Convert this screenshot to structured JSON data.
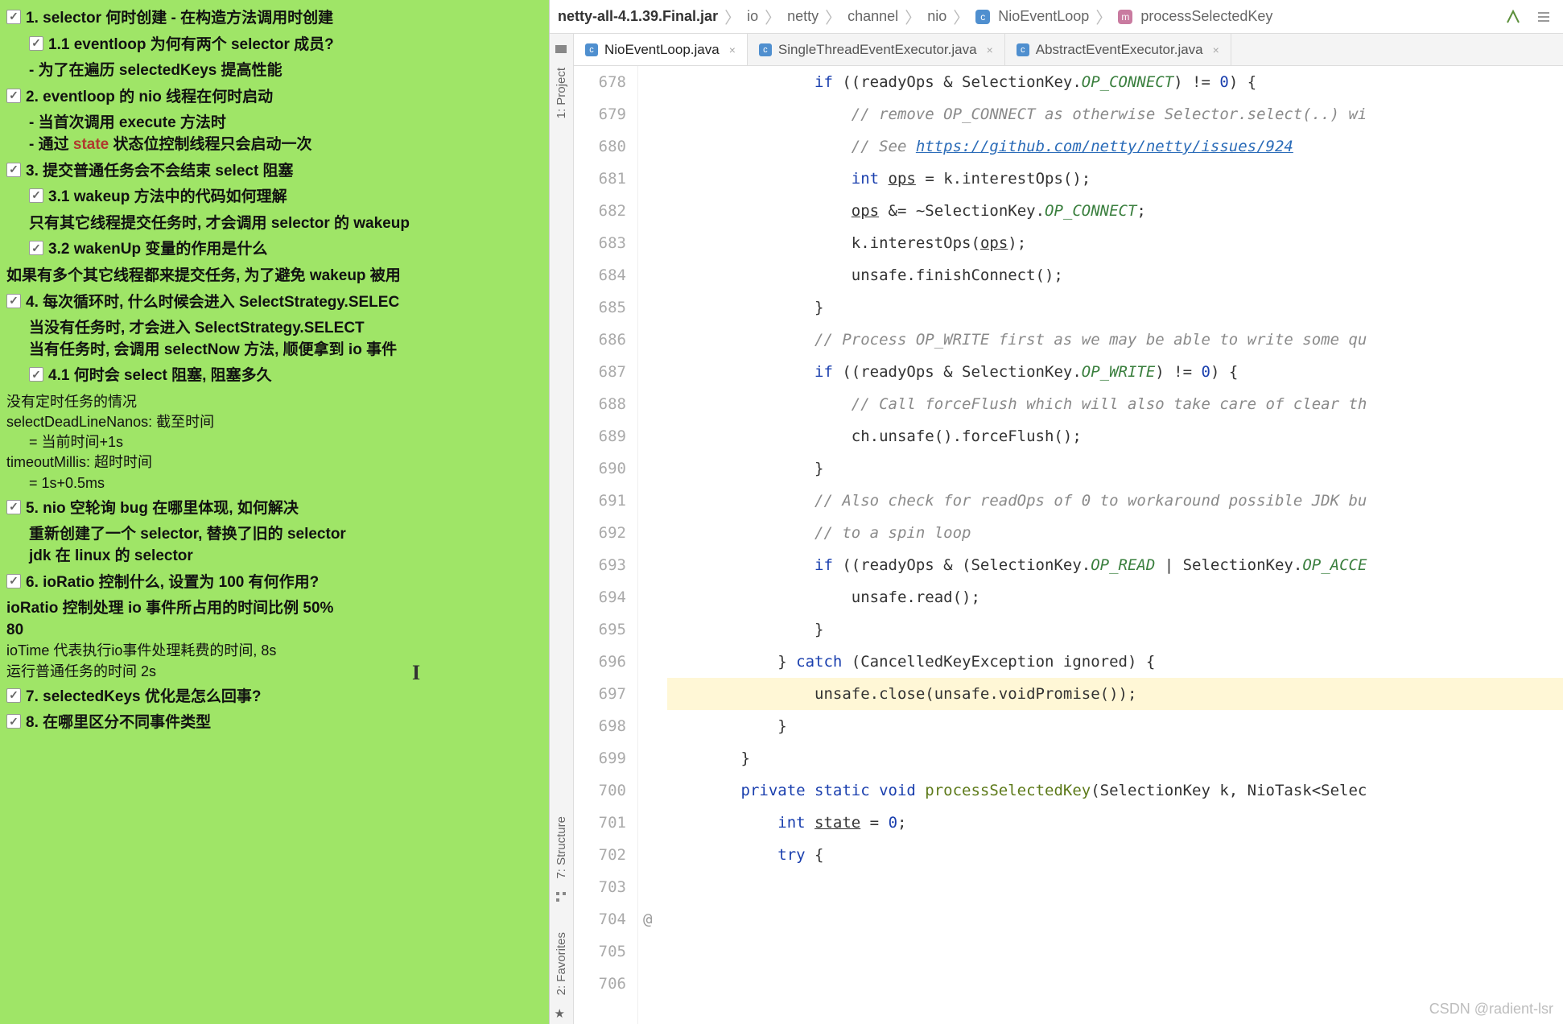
{
  "notes": {
    "n1": {
      "label": "1. selector 何时创建 - 在构造方法调用时创建"
    },
    "n1_1": {
      "label": "1.1 eventloop 为何有两个 selector 成员?",
      "sub": "- 为了在遍历 selectedKeys 提高性能"
    },
    "n2": {
      "label": "2. eventloop 的 nio 线程在何时启动",
      "sub1_a": "- 当首次调用 ",
      "sub1_b": "execute 方法时",
      "sub2_a": "- 通过 ",
      "sub2_b": "state",
      "sub2_c": " 状态位控制线程只会启动一次"
    },
    "n3": {
      "label": "3. 提交普通任务会不会结束 select 阻塞"
    },
    "n3_1": {
      "label": "3.1 wakeup 方法中的代码如何理解",
      "sub": "只有其它线程提交任务时, 才会调用 selector 的 wakeup"
    },
    "n3_2": {
      "label": "3.2 wakenUp 变量的作用是什么",
      "sub": "如果有多个其它线程都来提交任务, 为了避免 wakeup 被用"
    },
    "n4": {
      "label": "4. 每次循环时, 什么时候会进入 SelectStrategy.SELEC",
      "sub1": "当没有任务时, 才会进入 SelectStrategy.SELECT",
      "sub2": "当有任务时, 会调用 selectNow 方法, 顺便拿到 io 事件"
    },
    "n4_1": {
      "label": "4.1 何时会 select 阻塞, 阻塞多久",
      "p1": "没有定时任务的情况",
      "p2": "selectDeadLineNanos: 截至时间",
      "p3": "= 当前时间+1s",
      "p4": "timeoutMillis: 超时时间",
      "p5": "= 1s+0.5ms"
    },
    "n5": {
      "label": "5. nio 空轮询 bug 在哪里体现, 如何解决",
      "sub1": "重新创建了一个 selector, 替换了旧的 selector",
      "sub2": "jdk 在 linux 的 selector"
    },
    "n6": {
      "label": "6. ioRatio 控制什么, 设置为 100 有何作用?",
      "p1": "ioRatio 控制处理 io 事件所占用的时间比例 50%",
      "p2": "80",
      "p3": "ioTime 代表执行io事件处理耗费的时间, 8s",
      "p4": "运行普通任务的时间 2s"
    },
    "n7": {
      "label": "7. selectedKeys 优化是怎么回事?"
    },
    "n8": {
      "label": "8. 在哪里区分不同事件类型"
    },
    "check": "✓"
  },
  "crumb": {
    "jar": "netty-all-4.1.39.Final.jar",
    "p1": "io",
    "p2": "netty",
    "p3": "channel",
    "p4": "nio",
    "cls": "NioEventLoop",
    "mtd": "processSelectedKey",
    "ci_c": "c",
    "ci_m": "m"
  },
  "sidetabs": {
    "t1": "1: Project",
    "t2": "7: Structure",
    "t3": "2: Favorites"
  },
  "tabs": {
    "t1": "NioEventLoop.java",
    "t2": "SingleThreadEventExecutor.java",
    "t3": "AbstractEventExecutor.java",
    "x": "×",
    "c": "c"
  },
  "code": {
    "lines": [
      "678",
      "679",
      "680",
      "681",
      "682",
      "683",
      "684",
      "685",
      "686",
      "687",
      "688",
      "689",
      "690",
      "691",
      "692",
      "693",
      "694",
      "695",
      "696",
      "697",
      "698",
      "699",
      "700",
      "701",
      "702",
      "703",
      "704",
      "705",
      "706"
    ],
    "at": "@",
    "l678a": "                if ",
    "l678b": "((readyOps & SelectionKey.",
    "l678c": "OP_CONNECT",
    "l678d": ") != ",
    "l678e": "0",
    "l678f": ") {",
    "l679": "                    // remove OP_CONNECT as otherwise Selector.select(..) wi",
    "l680a": "                    // See ",
    "l680b": "https://github.com/netty/netty/issues/924",
    "l681a": "                    int ",
    "l681b": "ops",
    "l681c": " = k.interestOps();",
    "l682a": "                    ",
    "l682b": "ops",
    "l682c": " &= ~SelectionKey.",
    "l682d": "OP_CONNECT",
    "l682e": ";",
    "l683a": "                    k.interestOps(",
    "l683b": "ops",
    "l683c": ");",
    "l684": "",
    "l685": "                    unsafe.finishConnect();",
    "l686": "                }",
    "l687": "",
    "l688": "                // Process OP_WRITE first as we may be able to write some qu",
    "l689a": "                if ",
    "l689b": "((readyOps & SelectionKey.",
    "l689c": "OP_WRITE",
    "l689d": ") != ",
    "l689e": "0",
    "l689f": ") {",
    "l690": "                    // Call forceFlush which will also take care of clear th",
    "l691": "                    ch.unsafe().forceFlush();",
    "l692": "                }",
    "l693": "",
    "l694": "                // Also check for readOps of 0 to workaround possible JDK bu",
    "l695": "                // to a spin loop",
    "l696a": "                if ",
    "l696b": "((readyOps & (SelectionKey.",
    "l696c": "OP_READ",
    "l696d": " | SelectionKey.",
    "l696e": "OP_ACCE",
    "l697": "                    unsafe.read();",
    "l698": "                }",
    "l699a": "            } ",
    "l699b": "catch ",
    "l699c": "(CancelledKeyException ignored) {",
    "l700": "                unsafe.close(unsafe.voidPromise());",
    "l701": "            }",
    "l702": "        }",
    "l703": "",
    "l704a": "        private static void ",
    "l704b": "processSelectedKey",
    "l704c": "(SelectionKey k, NioTask<Selec",
    "l705a": "            int ",
    "l705b": "state",
    "l705c": " = ",
    "l705d": "0",
    "l705e": ";",
    "l706a": "            try ",
    "l706b": "{"
  },
  "watermark": "CSDN @radient-lsr"
}
